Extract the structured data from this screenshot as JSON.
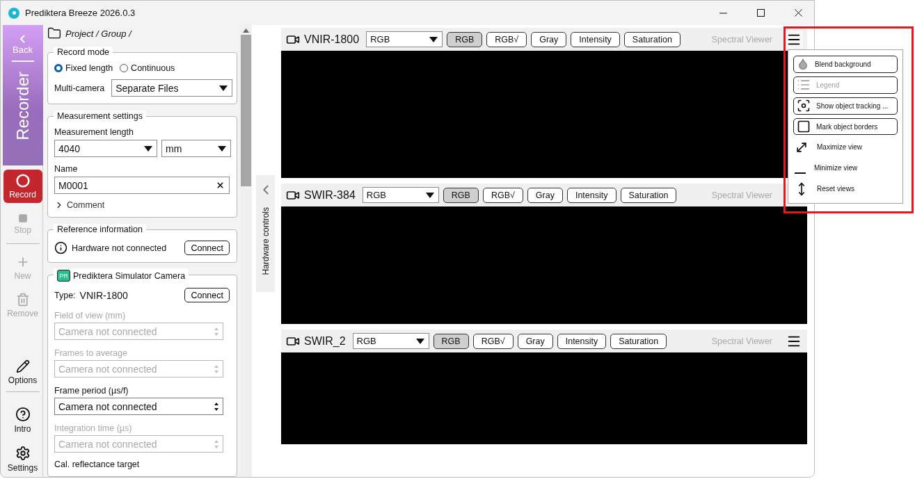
{
  "window": {
    "title": "Prediktera Breeze 2026.0.3"
  },
  "nav": {
    "back": "Back",
    "section": "Recorder",
    "items": [
      {
        "label": "Record",
        "kind": "record",
        "disabled": false
      },
      {
        "label": "Stop",
        "kind": "stop",
        "disabled": true
      },
      {
        "label": "New",
        "kind": "new",
        "disabled": true
      },
      {
        "label": "Remove",
        "kind": "remove",
        "disabled": true
      },
      {
        "label": "Options",
        "kind": "options",
        "disabled": false
      },
      {
        "label": "Intro",
        "kind": "intro",
        "disabled": false
      },
      {
        "label": "Settings",
        "kind": "settings",
        "disabled": false
      }
    ]
  },
  "breadcrumb": "Project / Group /",
  "record_mode": {
    "title": "Record mode",
    "options": [
      {
        "label": "Fixed length",
        "selected": true
      },
      {
        "label": "Continuous",
        "selected": false
      }
    ],
    "multi_camera": {
      "label": "Multi-camera",
      "value": "Separate Files"
    }
  },
  "measurement": {
    "title": "Measurement settings",
    "length_label": "Measurement length",
    "length_value": "4040",
    "unit": "mm",
    "name_label": "Name",
    "name_value": "M0001",
    "comment": {
      "label": "Comment",
      "expanded": false
    }
  },
  "reference": {
    "title": "Reference information",
    "status": "Hardware not connected",
    "button": "Connect"
  },
  "camera": {
    "badge": "PR",
    "title": "Prediktera Simulator Camera",
    "type_label": "Type:",
    "type_value": "VNIR-1800",
    "button": "Connect",
    "fields": [
      {
        "label": "Field of view (mm)",
        "value": "Camera not connected",
        "disabled": true
      },
      {
        "label": "Frames to average",
        "value": "Camera not connected",
        "disabled": true
      },
      {
        "label": "Frame period (µs/f)",
        "value": "Camera not connected",
        "disabled": false
      },
      {
        "label": "Integration time (µs)",
        "value": "Camera not connected",
        "disabled": true
      }
    ],
    "last_label": "Cal. reflectance target"
  },
  "hardware_tab": "Hardware controls",
  "viewers": [
    {
      "name": "VNIR-1800",
      "mode_value": "RGB",
      "modes": [
        {
          "label": "RGB",
          "selected": true
        },
        {
          "label": "RGB√",
          "selected": false
        },
        {
          "label": "Gray",
          "selected": false
        },
        {
          "label": "Intensity",
          "selected": false
        },
        {
          "label": "Saturation",
          "selected": false
        }
      ],
      "spectral": "Spectral Viewer"
    },
    {
      "name": "SWIR-384",
      "mode_value": "RGB",
      "modes": [
        {
          "label": "RGB",
          "selected": true
        },
        {
          "label": "RGB√",
          "selected": false
        },
        {
          "label": "Gray",
          "selected": false
        },
        {
          "label": "Intensity",
          "selected": false
        },
        {
          "label": "Saturation",
          "selected": false
        }
      ],
      "spectral": "Spectral Viewer"
    },
    {
      "name": "SWIR_2",
      "mode_value": "RGB",
      "modes": [
        {
          "label": "RGB",
          "selected": true
        },
        {
          "label": "RGB√",
          "selected": false
        },
        {
          "label": "Gray",
          "selected": false
        },
        {
          "label": "Intensity",
          "selected": false
        },
        {
          "label": "Saturation",
          "selected": false
        }
      ],
      "spectral": "Spectral Viewer"
    }
  ],
  "view_menu": {
    "open": true,
    "items": [
      {
        "kind": "blend",
        "label": "Blend background",
        "disabled": false
      },
      {
        "kind": "legend",
        "label": "Legend",
        "disabled": true
      },
      {
        "kind": "tracking",
        "label": "Show object tracking ...",
        "disabled": false
      },
      {
        "kind": "borders",
        "label": "Mark object borders",
        "disabled": false
      },
      {
        "kind": "maximize",
        "label": "Maximize view",
        "disabled": false
      },
      {
        "kind": "minimize",
        "label": "Minimize view",
        "disabled": false
      },
      {
        "kind": "reset",
        "label": "Reset views",
        "disabled": false
      }
    ]
  }
}
